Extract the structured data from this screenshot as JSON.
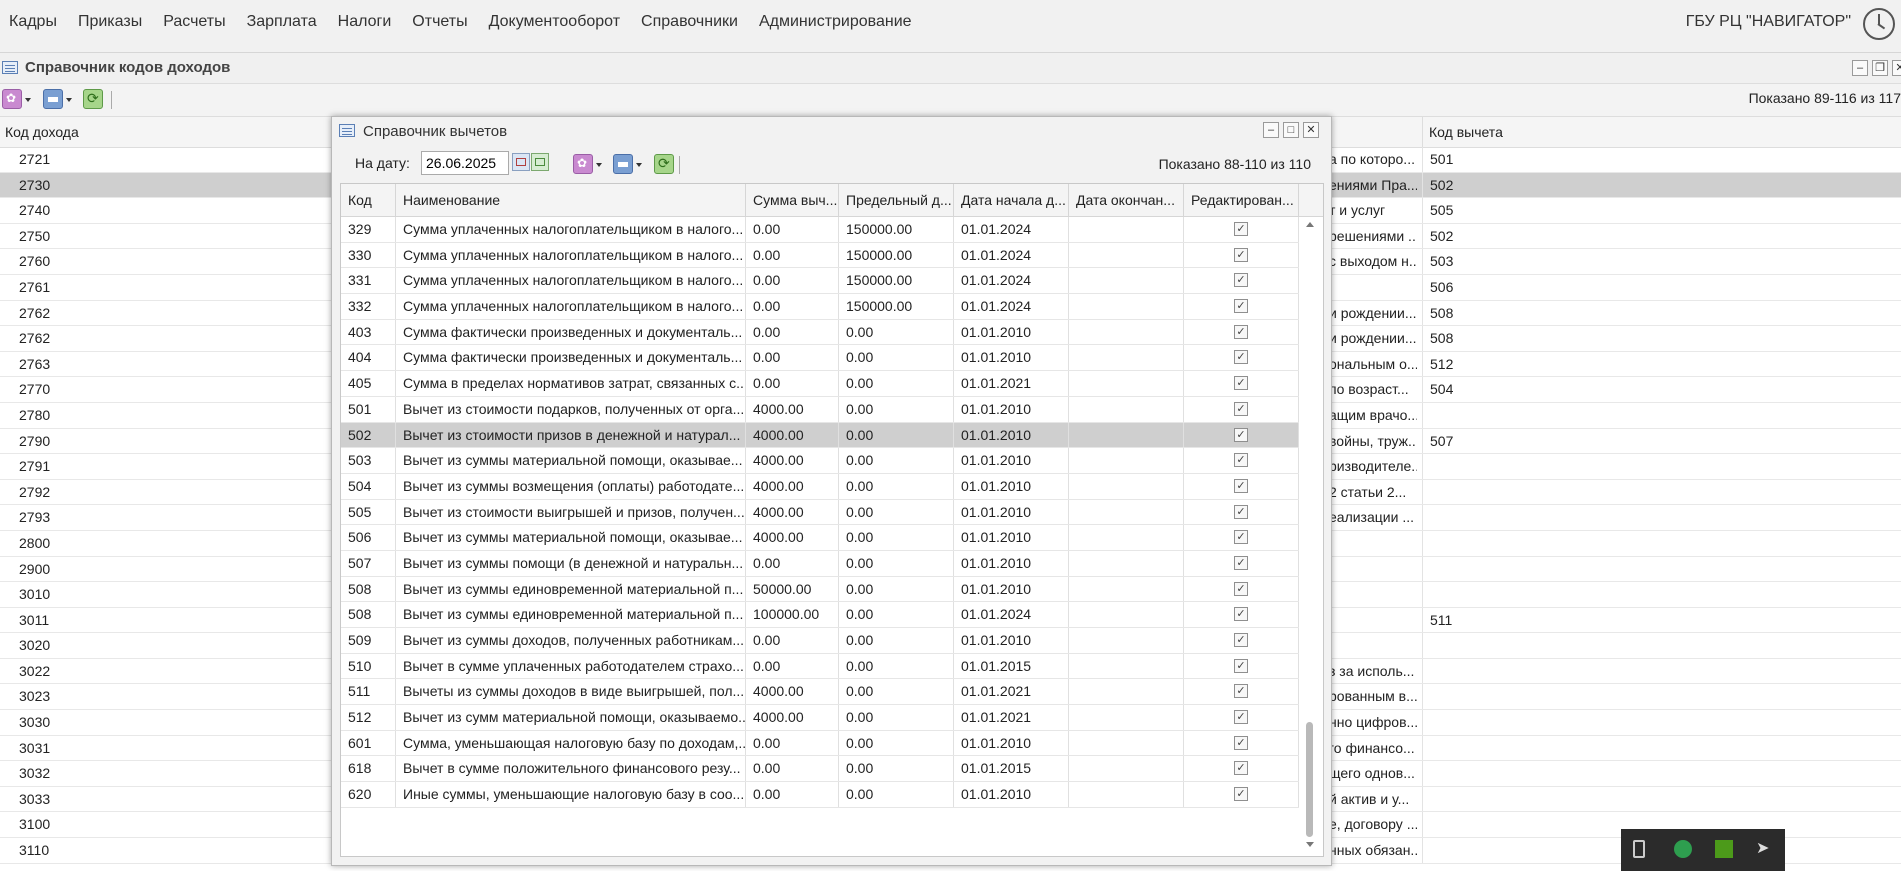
{
  "menu": {
    "items": [
      "Кадры",
      "Приказы",
      "Расчеты",
      "Зарплата",
      "Налоги",
      "Отчеты",
      "Документооборот",
      "Справочники",
      "Администрирование"
    ],
    "org": "ГБУ РЦ \"НАВИГАТОР\""
  },
  "back_window": {
    "title": "Справочник кодов доходов",
    "shown": "Показано 89-116 из 117",
    "columns": [
      "Код дохода",
      "Код вычета"
    ],
    "rows": [
      {
        "code": "2721",
        "desc": "а по которо...",
        "ded": "501"
      },
      {
        "code": "2730",
        "desc": "ениями Пра...",
        "ded": "502",
        "selected": true
      },
      {
        "code": "2740",
        "desc": "т и услуг",
        "ded": "505"
      },
      {
        "code": "2750",
        "desc": "решениями ...",
        "ded": "502"
      },
      {
        "code": "2760",
        "desc": "с выходом н...",
        "ded": "503"
      },
      {
        "code": "2761",
        "desc": "",
        "ded": "506"
      },
      {
        "code": "2762",
        "desc": "и рождении...",
        "ded": "508"
      },
      {
        "code": "2762",
        "desc": "и рождении...",
        "ded": "508"
      },
      {
        "code": "2763",
        "desc": "ональным о...",
        "ded": "512"
      },
      {
        "code": "2770",
        "desc": "по возраст...",
        "ded": "504"
      },
      {
        "code": "2780",
        "desc": "ащим врачо...",
        "ded": ""
      },
      {
        "code": "2790",
        "desc": "войны, труж...",
        "ded": "507"
      },
      {
        "code": "2791",
        "desc": "ризводителе...",
        "ded": ""
      },
      {
        "code": "2792",
        "desc": "2 статьи 2...",
        "ded": ""
      },
      {
        "code": "2793",
        "desc": "еализации ...",
        "ded": ""
      },
      {
        "code": "2800",
        "desc": "",
        "ded": ""
      },
      {
        "code": "2900",
        "desc": "",
        "ded": ""
      },
      {
        "code": "3010",
        "desc": "",
        "ded": ""
      },
      {
        "code": "3011",
        "desc": "",
        "ded": "511"
      },
      {
        "code": "3020",
        "desc": "",
        "ded": ""
      },
      {
        "code": "3022",
        "desc": "з за исполь...",
        "ded": ""
      },
      {
        "code": "3023",
        "desc": "рованным в...",
        "ded": ""
      },
      {
        "code": "3030",
        "desc": "нно цифров...",
        "ded": ""
      },
      {
        "code": "3031",
        "desc": "го финансо...",
        "ded": ""
      },
      {
        "code": "3032",
        "desc": "щего однов...",
        "ded": ""
      },
      {
        "code": "3033",
        "desc": "й актив и у...",
        "ded": ""
      },
      {
        "code": "3100",
        "desc": "е, договору ...",
        "ded": ""
      },
      {
        "code": "3110",
        "desc": "нных обязан...",
        "ded": ""
      }
    ]
  },
  "dialog": {
    "title": "Справочник вычетов",
    "date_label": "На дату:",
    "date_value": "26.06.2025",
    "shown": "Показано 88-110 из 110",
    "columns": [
      "Код",
      "Наименование",
      "Сумма выч...",
      "Предельный д...",
      "Дата начала д...",
      "Дата окончан...",
      "Редактирован..."
    ],
    "rows": [
      {
        "code": "329",
        "name": "Сумма уплаченных налогоплательщиком в налого...",
        "sum": "0.00",
        "limit": "150000.00",
        "start": "01.01.2024",
        "end": "",
        "edit": true
      },
      {
        "code": "330",
        "name": "Сумма уплаченных налогоплательщиком в налого...",
        "sum": "0.00",
        "limit": "150000.00",
        "start": "01.01.2024",
        "end": "",
        "edit": true
      },
      {
        "code": "331",
        "name": "Сумма уплаченных налогоплательщиком в налого...",
        "sum": "0.00",
        "limit": "150000.00",
        "start": "01.01.2024",
        "end": "",
        "edit": true
      },
      {
        "code": "332",
        "name": "Сумма уплаченных налогоплательщиком в налого...",
        "sum": "0.00",
        "limit": "150000.00",
        "start": "01.01.2024",
        "end": "",
        "edit": true
      },
      {
        "code": "403",
        "name": "Сумма фактически произведенных и документаль...",
        "sum": "0.00",
        "limit": "0.00",
        "start": "01.01.2010",
        "end": "",
        "edit": true
      },
      {
        "code": "404",
        "name": "Сумма фактически произведенных и документаль...",
        "sum": "0.00",
        "limit": "0.00",
        "start": "01.01.2010",
        "end": "",
        "edit": true
      },
      {
        "code": "405",
        "name": "Сумма в пределах нормативов затрат, связанных с...",
        "sum": "0.00",
        "limit": "0.00",
        "start": "01.01.2021",
        "end": "",
        "edit": true
      },
      {
        "code": "501",
        "name": "Вычет из стоимости подарков, полученных от орга...",
        "sum": "4000.00",
        "limit": "0.00",
        "start": "01.01.2010",
        "end": "",
        "edit": true
      },
      {
        "code": "502",
        "name": "Вычет из стоимости призов в денежной и натурал...",
        "sum": "4000.00",
        "limit": "0.00",
        "start": "01.01.2010",
        "end": "",
        "edit": true,
        "selected": true
      },
      {
        "code": "503",
        "name": "Вычет из суммы материальной помощи, оказывае...",
        "sum": "4000.00",
        "limit": "0.00",
        "start": "01.01.2010",
        "end": "",
        "edit": true
      },
      {
        "code": "504",
        "name": "Вычет из суммы возмещения (оплаты) работодате...",
        "sum": "4000.00",
        "limit": "0.00",
        "start": "01.01.2010",
        "end": "",
        "edit": true
      },
      {
        "code": "505",
        "name": "Вычет из стоимости выигрышей и призов, получен...",
        "sum": "4000.00",
        "limit": "0.00",
        "start": "01.01.2010",
        "end": "",
        "edit": true
      },
      {
        "code": "506",
        "name": "Вычет из суммы материальной помощи, оказывае...",
        "sum": "4000.00",
        "limit": "0.00",
        "start": "01.01.2010",
        "end": "",
        "edit": true
      },
      {
        "code": "507",
        "name": "Вычет из суммы помощи (в денежной и натуральн...",
        "sum": "0.00",
        "limit": "0.00",
        "start": "01.01.2010",
        "end": "",
        "edit": true
      },
      {
        "code": "508",
        "name": "Вычет из суммы единовременной материальной п...",
        "sum": "50000.00",
        "limit": "0.00",
        "start": "01.01.2010",
        "end": "",
        "edit": true
      },
      {
        "code": "508",
        "name": "Вычет из суммы единовременной материальной п...",
        "sum": "100000.00",
        "limit": "0.00",
        "start": "01.01.2024",
        "end": "",
        "edit": true
      },
      {
        "code": "509",
        "name": "Вычет из суммы доходов, полученных работникам...",
        "sum": "0.00",
        "limit": "0.00",
        "start": "01.01.2010",
        "end": "",
        "edit": true
      },
      {
        "code": "510",
        "name": "Вычет в сумме уплаченных работодателем страхо...",
        "sum": "0.00",
        "limit": "0.00",
        "start": "01.01.2015",
        "end": "",
        "edit": true
      },
      {
        "code": "511",
        "name": "Вычеты из суммы доходов в виде выигрышей, пол...",
        "sum": "4000.00",
        "limit": "0.00",
        "start": "01.01.2021",
        "end": "",
        "edit": true
      },
      {
        "code": "512",
        "name": "Вычет из сумм материальной помощи, оказываемо...",
        "sum": "4000.00",
        "limit": "0.00",
        "start": "01.01.2021",
        "end": "",
        "edit": true
      },
      {
        "code": "601",
        "name": "Сумма, уменьшающая налоговую базу по доходам,...",
        "sum": "0.00",
        "limit": "0.00",
        "start": "01.01.2010",
        "end": "",
        "edit": true
      },
      {
        "code": "618",
        "name": "Вычет в сумме положительного финансового резу...",
        "sum": "0.00",
        "limit": "0.00",
        "start": "01.01.2015",
        "end": "",
        "edit": true
      },
      {
        "code": "620",
        "name": "Иные суммы, уменьшающие налоговую базу в соо...",
        "sum": "0.00",
        "limit": "0.00",
        "start": "01.01.2010",
        "end": "",
        "edit": true
      }
    ]
  },
  "icons": {
    "tray": [
      "usb-icon",
      "shield-icon",
      "nvidia-icon",
      "telegram-icon"
    ],
    "checkbox_glyph": "✓"
  }
}
